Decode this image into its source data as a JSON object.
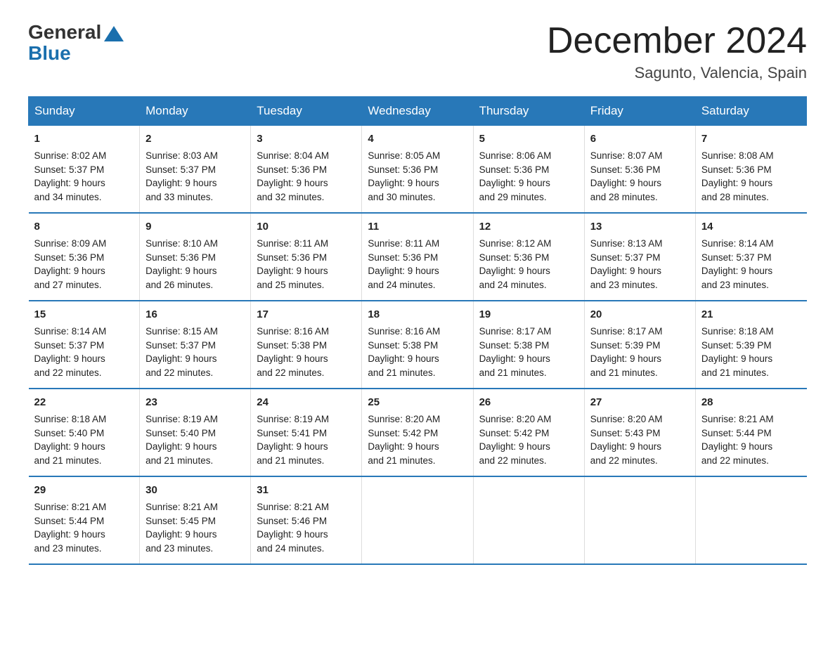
{
  "logo": {
    "text_general": "General",
    "text_blue": "Blue"
  },
  "header": {
    "month": "December 2024",
    "location": "Sagunto, Valencia, Spain"
  },
  "days_of_week": [
    "Sunday",
    "Monday",
    "Tuesday",
    "Wednesday",
    "Thursday",
    "Friday",
    "Saturday"
  ],
  "weeks": [
    [
      {
        "day": "1",
        "sunrise": "8:02 AM",
        "sunset": "5:37 PM",
        "daylight": "9 hours and 34 minutes."
      },
      {
        "day": "2",
        "sunrise": "8:03 AM",
        "sunset": "5:37 PM",
        "daylight": "9 hours and 33 minutes."
      },
      {
        "day": "3",
        "sunrise": "8:04 AM",
        "sunset": "5:36 PM",
        "daylight": "9 hours and 32 minutes."
      },
      {
        "day": "4",
        "sunrise": "8:05 AM",
        "sunset": "5:36 PM",
        "daylight": "9 hours and 30 minutes."
      },
      {
        "day": "5",
        "sunrise": "8:06 AM",
        "sunset": "5:36 PM",
        "daylight": "9 hours and 29 minutes."
      },
      {
        "day": "6",
        "sunrise": "8:07 AM",
        "sunset": "5:36 PM",
        "daylight": "9 hours and 28 minutes."
      },
      {
        "day": "7",
        "sunrise": "8:08 AM",
        "sunset": "5:36 PM",
        "daylight": "9 hours and 28 minutes."
      }
    ],
    [
      {
        "day": "8",
        "sunrise": "8:09 AM",
        "sunset": "5:36 PM",
        "daylight": "9 hours and 27 minutes."
      },
      {
        "day": "9",
        "sunrise": "8:10 AM",
        "sunset": "5:36 PM",
        "daylight": "9 hours and 26 minutes."
      },
      {
        "day": "10",
        "sunrise": "8:11 AM",
        "sunset": "5:36 PM",
        "daylight": "9 hours and 25 minutes."
      },
      {
        "day": "11",
        "sunrise": "8:11 AM",
        "sunset": "5:36 PM",
        "daylight": "9 hours and 24 minutes."
      },
      {
        "day": "12",
        "sunrise": "8:12 AM",
        "sunset": "5:36 PM",
        "daylight": "9 hours and 24 minutes."
      },
      {
        "day": "13",
        "sunrise": "8:13 AM",
        "sunset": "5:37 PM",
        "daylight": "9 hours and 23 minutes."
      },
      {
        "day": "14",
        "sunrise": "8:14 AM",
        "sunset": "5:37 PM",
        "daylight": "9 hours and 23 minutes."
      }
    ],
    [
      {
        "day": "15",
        "sunrise": "8:14 AM",
        "sunset": "5:37 PM",
        "daylight": "9 hours and 22 minutes."
      },
      {
        "day": "16",
        "sunrise": "8:15 AM",
        "sunset": "5:37 PM",
        "daylight": "9 hours and 22 minutes."
      },
      {
        "day": "17",
        "sunrise": "8:16 AM",
        "sunset": "5:38 PM",
        "daylight": "9 hours and 22 minutes."
      },
      {
        "day": "18",
        "sunrise": "8:16 AM",
        "sunset": "5:38 PM",
        "daylight": "9 hours and 21 minutes."
      },
      {
        "day": "19",
        "sunrise": "8:17 AM",
        "sunset": "5:38 PM",
        "daylight": "9 hours and 21 minutes."
      },
      {
        "day": "20",
        "sunrise": "8:17 AM",
        "sunset": "5:39 PM",
        "daylight": "9 hours and 21 minutes."
      },
      {
        "day": "21",
        "sunrise": "8:18 AM",
        "sunset": "5:39 PM",
        "daylight": "9 hours and 21 minutes."
      }
    ],
    [
      {
        "day": "22",
        "sunrise": "8:18 AM",
        "sunset": "5:40 PM",
        "daylight": "9 hours and 21 minutes."
      },
      {
        "day": "23",
        "sunrise": "8:19 AM",
        "sunset": "5:40 PM",
        "daylight": "9 hours and 21 minutes."
      },
      {
        "day": "24",
        "sunrise": "8:19 AM",
        "sunset": "5:41 PM",
        "daylight": "9 hours and 21 minutes."
      },
      {
        "day": "25",
        "sunrise": "8:20 AM",
        "sunset": "5:42 PM",
        "daylight": "9 hours and 21 minutes."
      },
      {
        "day": "26",
        "sunrise": "8:20 AM",
        "sunset": "5:42 PM",
        "daylight": "9 hours and 22 minutes."
      },
      {
        "day": "27",
        "sunrise": "8:20 AM",
        "sunset": "5:43 PM",
        "daylight": "9 hours and 22 minutes."
      },
      {
        "day": "28",
        "sunrise": "8:21 AM",
        "sunset": "5:44 PM",
        "daylight": "9 hours and 22 minutes."
      }
    ],
    [
      {
        "day": "29",
        "sunrise": "8:21 AM",
        "sunset": "5:44 PM",
        "daylight": "9 hours and 23 minutes."
      },
      {
        "day": "30",
        "sunrise": "8:21 AM",
        "sunset": "5:45 PM",
        "daylight": "9 hours and 23 minutes."
      },
      {
        "day": "31",
        "sunrise": "8:21 AM",
        "sunset": "5:46 PM",
        "daylight": "9 hours and 24 minutes."
      },
      null,
      null,
      null,
      null
    ]
  ]
}
